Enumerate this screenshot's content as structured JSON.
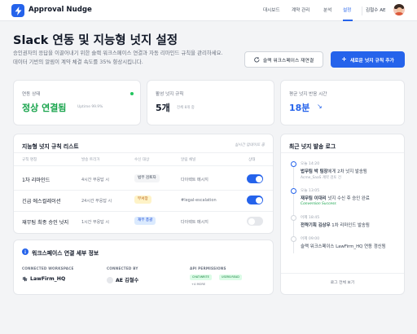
{
  "header": {
    "app_title": "Approval Nudge",
    "nav": [
      "대시보드",
      "계약 관리",
      "분석",
      "설정"
    ],
    "active_nav": "설정",
    "user_name": "김철수 AE"
  },
  "page": {
    "title": "Slack 연동 및 지능형 넛지 설정",
    "description": "승인권자의 응답을 이끌어내기 위한 슬랙 워크스페이스 연결과 자동 리마인드 규칙을 관리하세요. 데이터 기반의 알림이 계약 체결 속도를 35% 향상시킵니다.",
    "reconnect_button": "슬랙 워크스페이스 재연결",
    "add_rule_button": "새로운 넛지 규칙 추가"
  },
  "stats": [
    {
      "label": "연동 상태",
      "value": "정상 연결됨",
      "sub": "Uptime 99.9%",
      "color": "#16a34a"
    },
    {
      "label": "활성 넛지 규칙",
      "value": "5개",
      "sub": "전체 8개 중",
      "color": "#111827"
    },
    {
      "label": "평균 넛지 반응 시간",
      "value": "18분",
      "trend": "↘",
      "color": "#2563eb"
    }
  ],
  "rules": {
    "title": "지능형 넛지 규칙 리스트",
    "live_label": "실시간 업데이트 중",
    "columns": [
      "규칙 명칭",
      "발송 트리거",
      "수신 대상",
      "알림 채널",
      "상태"
    ],
    "rows": [
      {
        "name": "1차 리마인드",
        "trigger": "4시간 무응답 시",
        "target": "법무 검토자",
        "tag_bg": "#f3f4f6",
        "tag_color": "#374151",
        "channel": "다이렉트 메시지",
        "enabled": true
      },
      {
        "name": "긴급 에스컬레이션",
        "trigger": "24시간 무응답 시",
        "target": "부서장",
        "tag_bg": "#fef3c7",
        "tag_color": "#b45309",
        "channel": "#legal-escalation",
        "enabled": true
      },
      {
        "name": "재무팀 최종 승인 넛지",
        "trigger": "1시간 무응답 시",
        "target": "재무 총괄",
        "tag_bg": "#dbeafe",
        "tag_color": "#1d4ed8",
        "channel": "다이렉트 메시지",
        "enabled": false
      }
    ]
  },
  "connection": {
    "title": "워크스페이스 연결 세부 정보",
    "workspace_label": "CONNECTED WORKSPACE",
    "workspace_value": "LawFirm_HQ",
    "connected_by_label": "CONNECTED BY",
    "connected_by_value": "AE 김철수",
    "permissions_label": "API PERMISSIONS",
    "permissions": [
      "CHAT:WRITE",
      "USERS:READ"
    ],
    "permissions_more": "+4 MORE"
  },
  "log": {
    "title": "최근 넛지 발송 로그",
    "entries": [
      {
        "time": "오늘 14:20",
        "text_bold": "법무팀 박 팀장",
        "text_rest": "에게 2차 넛지 발송됨",
        "sub": "Acme_SaaS 계약 검토 건",
        "status": "",
        "active": true
      },
      {
        "time": "오늘 13:05",
        "text_bold": "재무팀 이대리",
        "text_rest": " 넛지 수신 후 승인 완료",
        "sub": "",
        "status": "Conversion Success",
        "active": true
      },
      {
        "time": "어제 18:45",
        "text_bold": "전략기획 김상무",
        "text_rest": " 1차 리마인드 발송됨",
        "sub": "",
        "status": "",
        "active": false
      },
      {
        "time": "어제 09:00",
        "text_bold": "",
        "text_rest": "슬랙 워크스페이스 LawFirm_HQ 연동 갱신됨",
        "sub": "",
        "status": "",
        "active": false
      }
    ],
    "view_all": "로그 전체 보기"
  }
}
